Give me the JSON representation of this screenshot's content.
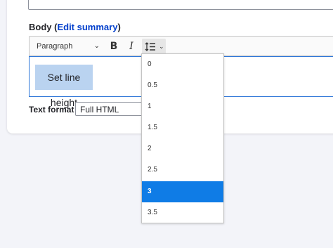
{
  "body_field": {
    "label_prefix": "Body (",
    "edit_summary": "Edit summary",
    "label_suffix": ")"
  },
  "toolbar": {
    "heading": "Paragraph",
    "bold": "B",
    "italic": "I",
    "line_height_icon": "line-height-icon"
  },
  "editor": {
    "selected_text": "Set line height"
  },
  "text_format": {
    "label": "Text format",
    "value": "Full HTML"
  },
  "line_height_dropdown": {
    "options": [
      "0",
      "0.5",
      "1",
      "1.5",
      "2",
      "2.5",
      "3",
      "3.5"
    ],
    "active": "3"
  },
  "colors": {
    "accent": "#0f7ce6",
    "link": "#003ecc",
    "selection": "#bad3f0"
  }
}
